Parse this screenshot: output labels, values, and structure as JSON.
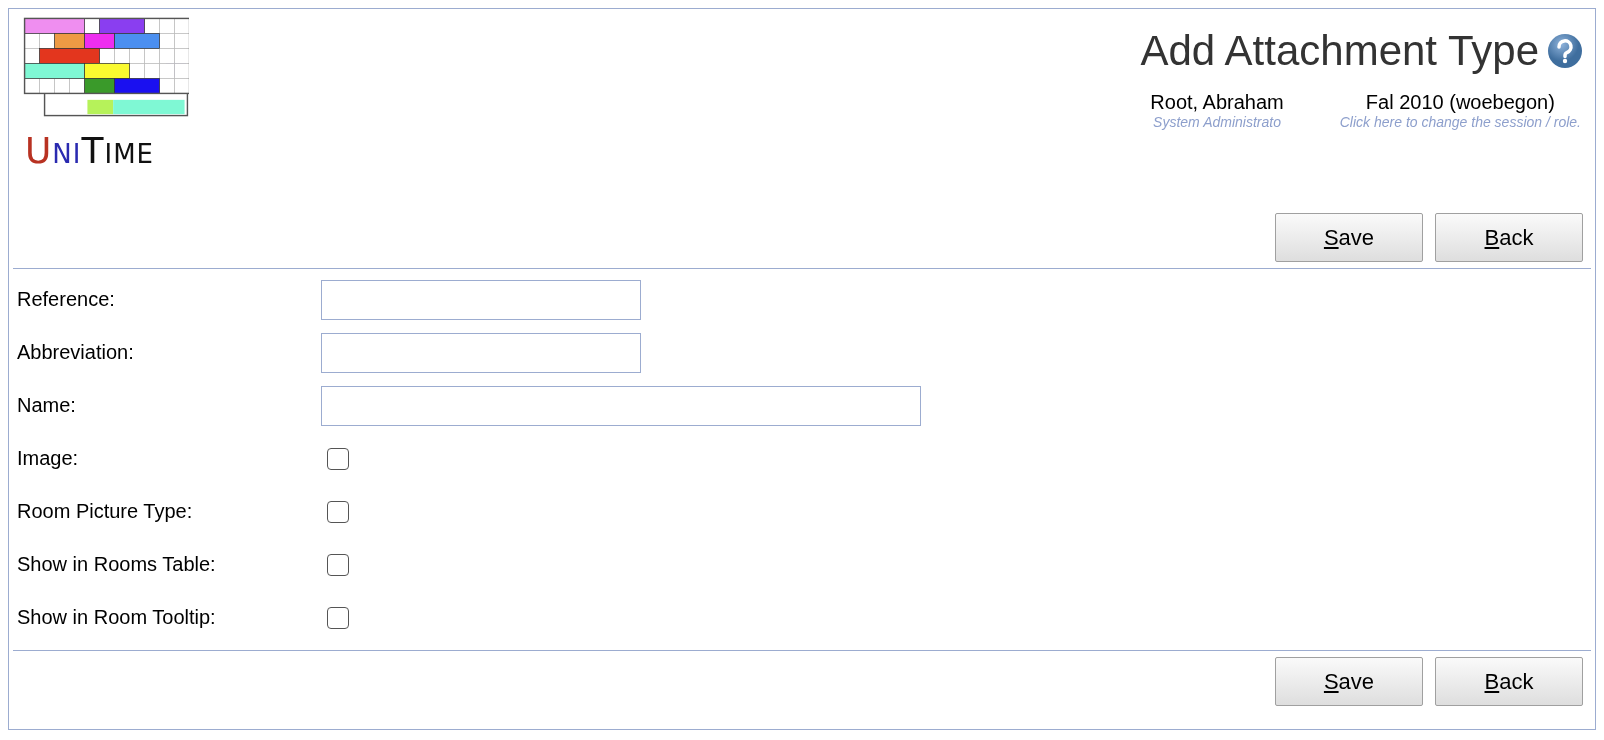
{
  "logo": {
    "letters": [
      {
        "text": "U",
        "color": "#b83222"
      },
      {
        "text": "NI",
        "color": "#2a2ab0"
      },
      {
        "text": "T",
        "color": "#111111"
      },
      {
        "text": "IME",
        "color": "#111111"
      }
    ]
  },
  "header": {
    "title": "Add Attachment Type",
    "user": {
      "name": "Root, Abraham",
      "role": "System Administrato"
    },
    "session": {
      "name": "Fal 2010 (woebegon)",
      "hint": "Click here to change the session / role."
    }
  },
  "top_buttons": [
    {
      "mnemonic": "S",
      "rest": "ave"
    },
    {
      "mnemonic": "B",
      "rest": "ack"
    }
  ],
  "fields": [
    {
      "kind": "short_text",
      "label": "Reference:"
    },
    {
      "kind": "short_text",
      "label": "Abbreviation:"
    },
    {
      "kind": "long_text",
      "label": "Name:"
    },
    {
      "kind": "checkbox",
      "label": "Image:",
      "checked": false
    },
    {
      "kind": "checkbox",
      "label": "Room Picture Type:",
      "checked": false
    },
    {
      "kind": "checkbox",
      "label": "Show in Rooms Table:",
      "checked": false
    },
    {
      "kind": "checkbox",
      "label": "Show in Room Tooltip:",
      "checked": false
    }
  ],
  "bottom_buttons": [
    {
      "mnemonic": "S",
      "rest": "ave"
    },
    {
      "mnemonic": "B",
      "rest": "ack"
    }
  ]
}
